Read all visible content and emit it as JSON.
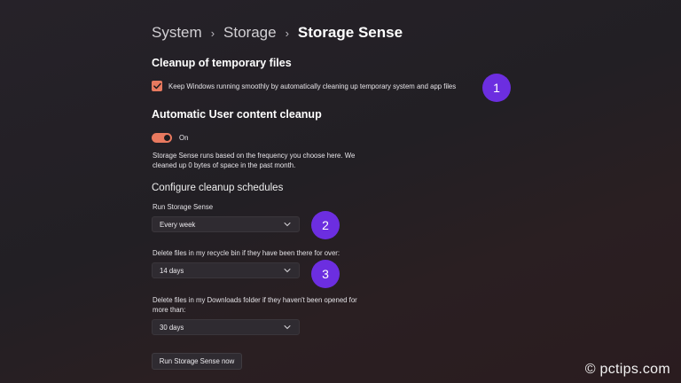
{
  "breadcrumb": {
    "items": [
      "System",
      "Storage",
      "Storage Sense"
    ],
    "separator": "›"
  },
  "cleanup_temp": {
    "title": "Cleanup of temporary files",
    "checkbox_label": "Keep Windows running smoothly by automatically cleaning up temporary system and app files",
    "checked": true
  },
  "auto_cleanup": {
    "title": "Automatic User content cleanup",
    "toggle_state": "On",
    "description_line1": "Storage Sense runs based on the frequency you choose here. We",
    "description_line2": "cleaned up 0 bytes of space in the past month."
  },
  "schedules": {
    "title": "Configure cleanup schedules",
    "run_label": "Run Storage Sense",
    "run_value": "Every week",
    "recycle_label": "Delete files in my recycle bin if they have been there for over:",
    "recycle_value": "14 days",
    "downloads_label_line1": "Delete files in my Downloads folder if they haven't been opened for",
    "downloads_label_line2": "more than:",
    "downloads_value": "30 days",
    "run_now_button": "Run Storage Sense now"
  },
  "annotations": [
    "1",
    "2",
    "3"
  ],
  "watermark": "© pctips.com",
  "colors": {
    "accent": "#e8795f",
    "badge": "#6c2ee0",
    "background": "#231f25"
  }
}
